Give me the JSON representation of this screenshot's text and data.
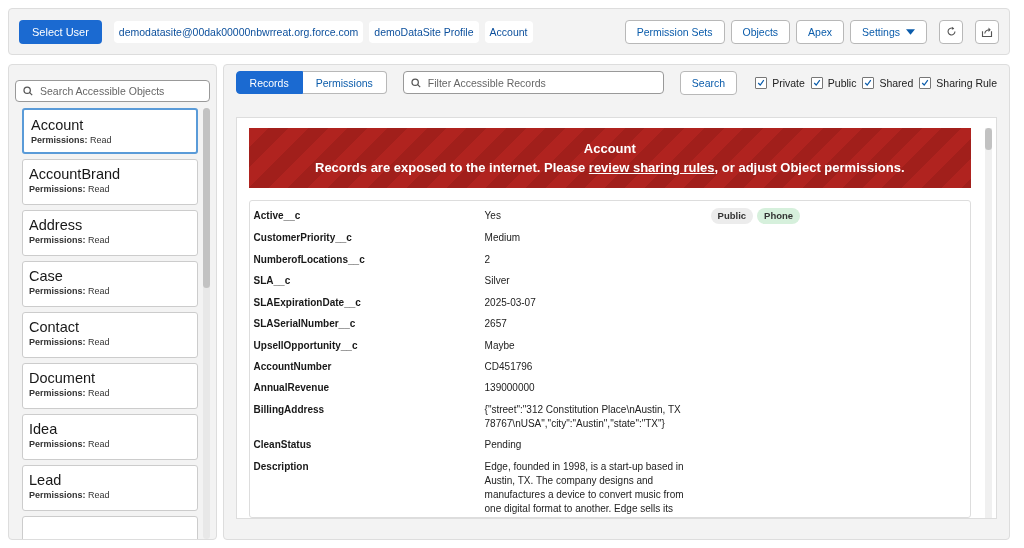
{
  "header": {
    "select_button": "Select User",
    "context": [
      {
        "label": "demodatasite@00dak00000nbwrreat.org.force.com"
      },
      {
        "label": "demoDataSite Profile"
      },
      {
        "label": "Account"
      }
    ],
    "nav_buttons": [
      {
        "label": "Permission Sets",
        "kind": "text"
      },
      {
        "label": "Objects",
        "kind": "text"
      },
      {
        "label": "Apex",
        "kind": "text"
      },
      {
        "label": "Settings",
        "kind": "menu"
      },
      {
        "kind": "refresh"
      },
      {
        "kind": "export"
      }
    ]
  },
  "sidebar": {
    "search": {
      "placeholder": "Search Accessible Objects"
    },
    "objects": [
      {
        "name": "Account",
        "permissions_label": "Permissions:",
        "permissions": "Read",
        "selected": true
      },
      {
        "name": "AccountBrand",
        "permissions_label": "Permissions:",
        "permissions": "Read",
        "selected": false
      },
      {
        "name": "Address",
        "permissions_label": "Permissions:",
        "permissions": "Read",
        "selected": false
      },
      {
        "name": "Case",
        "permissions_label": "Permissions:",
        "permissions": "Read",
        "selected": false
      },
      {
        "name": "Contact",
        "permissions_label": "Permissions:",
        "permissions": "Read",
        "selected": false
      },
      {
        "name": "Document",
        "permissions_label": "Permissions:",
        "permissions": "Read",
        "selected": false
      },
      {
        "name": "Idea",
        "permissions_label": "Permissions:",
        "permissions": "Read",
        "selected": false
      },
      {
        "name": "Lead",
        "permissions_label": "Permissions:",
        "permissions": "Read",
        "selected": false
      }
    ]
  },
  "main": {
    "tabs": [
      {
        "label": "Records",
        "selected": true
      },
      {
        "label": "Permissions",
        "selected": false
      }
    ],
    "filter": {
      "placeholder": "Filter Accessible Records"
    },
    "search_button": "Search",
    "filters": [
      {
        "label": "Private",
        "checked": true
      },
      {
        "label": "Public",
        "checked": true
      },
      {
        "label": "Shared",
        "checked": true
      },
      {
        "label": "Sharing Rule",
        "checked": true
      }
    ],
    "banner": {
      "title": "Account",
      "message": "Records are exposed to the internet. Please ",
      "link": "review sharing rules",
      "message_end": ", or adjust Object permissions."
    },
    "record": {
      "tags": [
        {
          "label": "Public",
          "color": "#ececec"
        },
        {
          "label": "Phone",
          "color": "#d6f0dc"
        }
      ],
      "fields": [
        {
          "name": "Active__c",
          "value": "Yes"
        },
        {
          "name": "CustomerPriority__c",
          "value": "Medium"
        },
        {
          "name": "NumberofLocations__c",
          "value": "2"
        },
        {
          "name": "SLA__c",
          "value": "Silver"
        },
        {
          "name": "SLAExpirationDate__c",
          "value": "2025-03-07"
        },
        {
          "name": "SLASerialNumber__c",
          "value": "2657"
        },
        {
          "name": "UpsellOpportunity__c",
          "value": "Maybe"
        },
        {
          "name": "AccountNumber",
          "value": "CD451796"
        },
        {
          "name": "AnnualRevenue",
          "value": "139000000"
        },
        {
          "name": "BillingAddress",
          "value": "{\"street\":\"312 Constitution Place\\nAustin, TX 78767\\nUSA\",\"city\":\"Austin\",\"state\":\"TX\"}"
        },
        {
          "name": "CleanStatus",
          "value": "Pending"
        },
        {
          "name": "Description",
          "value": "Edge, founded in 1998, is a start-up based in Austin, TX. The company designs and manufactures a device to convert music from one digital format to another. Edge sells its"
        }
      ]
    }
  }
}
